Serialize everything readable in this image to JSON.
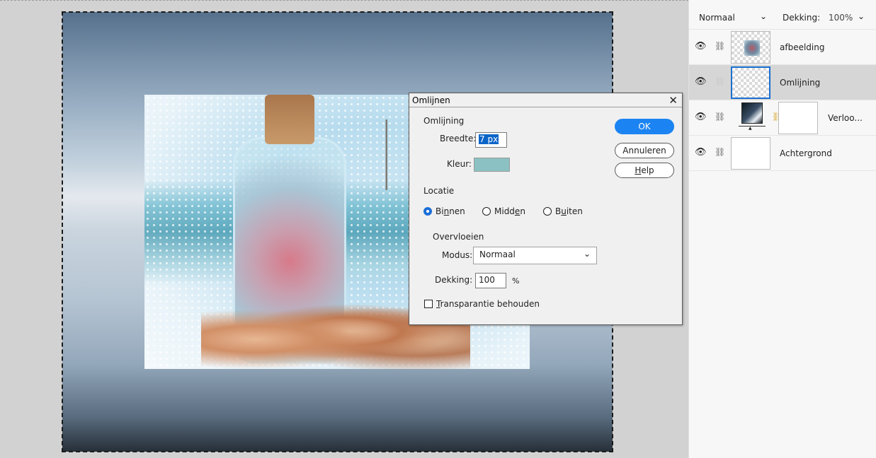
{
  "panel": {
    "blend_mode": "Normaal",
    "opacity_label": "Dekking:",
    "opacity_value": "100%",
    "layers": [
      {
        "name": "afbeelding"
      },
      {
        "name": "Omlijning"
      },
      {
        "name": "Verloo..."
      },
      {
        "name": "Achtergrond"
      }
    ]
  },
  "dialog": {
    "title": "Omlijnen",
    "close": "✕",
    "section_stroke": "Omlijning",
    "width_label": "Breedte:",
    "width_value": "7 px",
    "color_label": "Kleur:",
    "color_value": "#8bc1c2",
    "location_label": "Locatie",
    "location_options": {
      "inside_prefix": "Bi",
      "inside_ul": "n",
      "inside_suffix": "nen",
      "center_prefix": "Midd",
      "center_ul": "e",
      "center_suffix": "n",
      "outside_prefix": "B",
      "outside_ul": "u",
      "outside_suffix": "iten"
    },
    "location_selected": "Binnen",
    "blend_label": "Overvloeien",
    "mode_label": "Modus:",
    "mode_value": "Normaal",
    "opacity_label": "Dekking:",
    "opacity_value": "100",
    "percent": "%",
    "preserve_ul": "T",
    "preserve_rest": "ransparantie behouden",
    "ok_label": "OK",
    "cancel_label": "Annuleren",
    "help_ul": "H",
    "help_rest": "elp"
  },
  "colors": {
    "accent": "#1c84f2",
    "selection": "#0a64c8",
    "stroke_color": "#8bc1c2"
  }
}
